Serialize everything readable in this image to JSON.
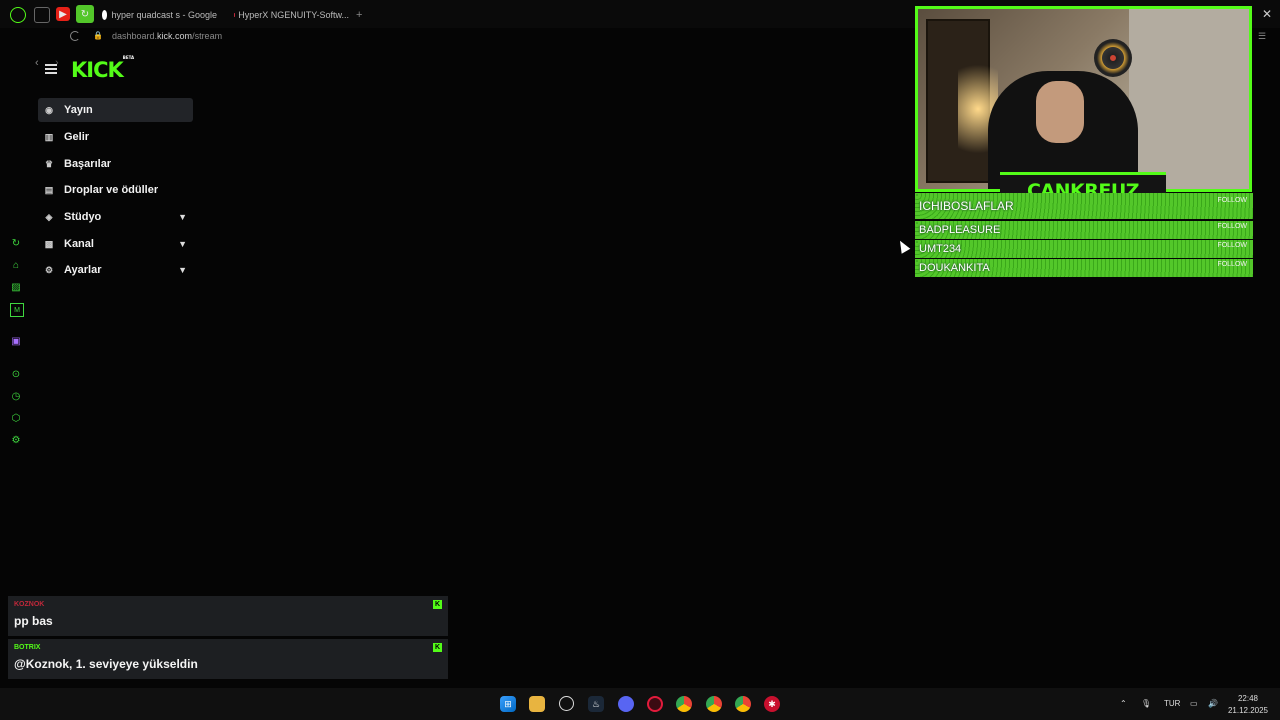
{
  "browser": {
    "tabs": [
      {
        "label": "hyper quadcast s - Google"
      },
      {
        "label": "HyperX NGENUITY-Softw..."
      }
    ],
    "url_prefix": "dashboard.",
    "url_host": "kick.com",
    "url_path": "/stream",
    "new_tab": "+"
  },
  "kick": {
    "logo": "KICK",
    "logo_badge": "BETA",
    "menu": [
      {
        "label": "Yayın",
        "icon": "broadcast-icon",
        "active": true
      },
      {
        "label": "Gelir",
        "icon": "chart-icon"
      },
      {
        "label": "Başarılar",
        "icon": "trophy-icon"
      },
      {
        "label": "Droplar ve ödüller",
        "icon": "gift-icon"
      },
      {
        "label": "Stüdyo",
        "icon": "studio-icon",
        "expandable": true
      },
      {
        "label": "Kanal",
        "icon": "channel-icon",
        "expandable": true
      },
      {
        "label": "Ayarlar",
        "icon": "gear-icon",
        "expandable": true
      }
    ]
  },
  "overlay": {
    "streamer_name": "CANKREUZ",
    "followers": [
      {
        "name": "ICHIBOSLAFLAR",
        "action": "FOLLOW"
      },
      {
        "name": "BADPLEASURE",
        "action": "FOLLOW"
      },
      {
        "name": "UMT234",
        "action": "FOLLOW"
      },
      {
        "name": "DOUKANKITA",
        "action": "FOLLOW"
      }
    ],
    "accent": "#53fc18"
  },
  "chat": [
    {
      "user": "KOZNOK",
      "user_color": "#c0283a",
      "message": "pp bas"
    },
    {
      "user": "BOTRIX",
      "user_color": "#53fc18",
      "message": "@Koznok, 1. seviyeye yükseldin"
    }
  ],
  "taskbar": {
    "language": "TUR",
    "time": "22:48",
    "date": "21.12.2025"
  }
}
